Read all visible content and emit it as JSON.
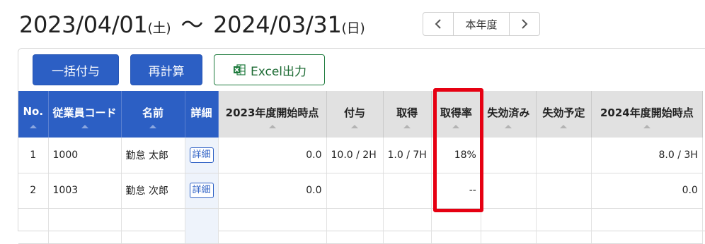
{
  "period": {
    "start_date": "2023/04/01",
    "start_dow": "(土)",
    "separator": "〜",
    "end_date": "2024/03/31",
    "end_dow": "(日)"
  },
  "fiscal_nav": {
    "prev_icon": "chevron-left-icon",
    "label": "本年度",
    "next_icon": "chevron-right-icon"
  },
  "toolbar": {
    "bulk_grant_label": "一括付与",
    "recalc_label": "再計算",
    "excel_label": "Excel出力",
    "excel_icon": "excel-icon",
    "primary_color": "#2c5fc4",
    "excel_color": "#1d6b34"
  },
  "table": {
    "columns": [
      "No.",
      "従業員コード",
      "名前",
      "詳細",
      "2023年度開始時点",
      "付与",
      "取得",
      "取得率",
      "失効済み",
      "失効予定",
      "2024年度開始時点"
    ],
    "rows": [
      {
        "no": "1",
        "code": "1000",
        "name": "勤怠 太郎",
        "detail": "詳細",
        "start_2023": "0.0",
        "granted": "10.0 / 2H",
        "taken": "1.0 / 7H",
        "rate": "18%",
        "expired": "",
        "to_expire": "",
        "start_2024": "8.0 / 3H"
      },
      {
        "no": "2",
        "code": "1003",
        "name": "勤怠 次郎",
        "detail": "詳細",
        "start_2023": "0.0",
        "granted": "",
        "taken": "",
        "rate": "--",
        "expired": "",
        "to_expire": "",
        "start_2024": "0.0"
      }
    ]
  },
  "highlight": {
    "column": "取得率",
    "color": "#e60012"
  }
}
